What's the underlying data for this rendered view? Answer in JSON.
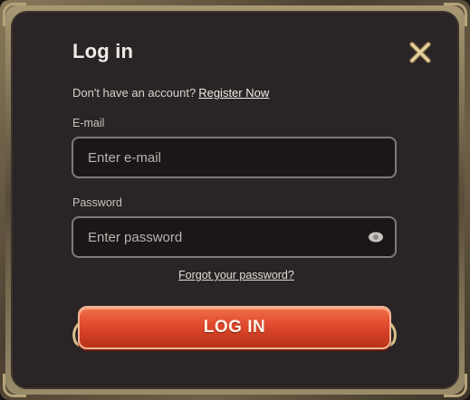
{
  "dialog": {
    "title": "Log in",
    "signup_prompt": "Don't have an account?",
    "signup_link": "Register Now",
    "email_label": "E-mail",
    "email_placeholder": "Enter e-mail",
    "email_value": "",
    "password_label": "Password",
    "password_placeholder": "Enter password",
    "password_value": "",
    "forgot_link": "Forgot your password?",
    "login_button": "LOG IN"
  },
  "icons": {
    "close": "close-icon",
    "show_password": "eye-icon"
  },
  "colors": {
    "panel": "#2a2426",
    "frame_gold": "#b6a37a",
    "button_red": "#e0482c",
    "text": "#f0ebe6"
  }
}
